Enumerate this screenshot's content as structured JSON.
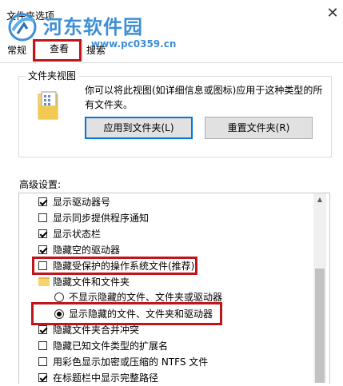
{
  "window": {
    "title": "文件夹选项",
    "close_glyph": "✕"
  },
  "watermark": {
    "site_name": "河东软件园",
    "url": "www.pc0359.cn"
  },
  "tabs": [
    {
      "label": "常规"
    },
    {
      "label": "查看"
    },
    {
      "label": "搜索"
    }
  ],
  "folder_views": {
    "group_label": "文件夹视图",
    "description": "你可以将此视图(如详细信息或图标)应用于这种类型的所有文件夹。",
    "apply_label": "应用到文件夹(L)",
    "reset_label": "重置文件夹(R)"
  },
  "advanced": {
    "label": "高级设置:",
    "items": [
      {
        "type": "checkbox",
        "checked": true,
        "label": "显示驱动器号"
      },
      {
        "type": "checkbox",
        "checked": false,
        "label": "显示同步提供程序通知"
      },
      {
        "type": "checkbox",
        "checked": true,
        "label": "显示状态栏"
      },
      {
        "type": "checkbox",
        "checked": true,
        "label": "隐藏空的驱动器"
      },
      {
        "type": "checkbox",
        "checked": false,
        "label": "隐藏受保护的操作系统文件(推荐)"
      },
      {
        "type": "folder",
        "label": "隐藏文件和文件夹"
      },
      {
        "type": "radio",
        "selected": false,
        "label": "不显示隐藏的文件、文件夹或驱动器"
      },
      {
        "type": "radio",
        "selected": true,
        "label": "显示隐藏的文件、文件夹和驱动器"
      },
      {
        "type": "checkbox",
        "checked": true,
        "label": "隐藏文件夹合并冲突"
      },
      {
        "type": "checkbox",
        "checked": false,
        "label": "隐藏已知文件类型的扩展名"
      },
      {
        "type": "checkbox",
        "checked": false,
        "label": "用彩色显示加密或压缩的 NTFS 文件"
      },
      {
        "type": "checkbox",
        "checked": true,
        "label": "在标题栏中显示完整路径"
      }
    ]
  },
  "scrollbar": {
    "up_glyph": "▲"
  }
}
